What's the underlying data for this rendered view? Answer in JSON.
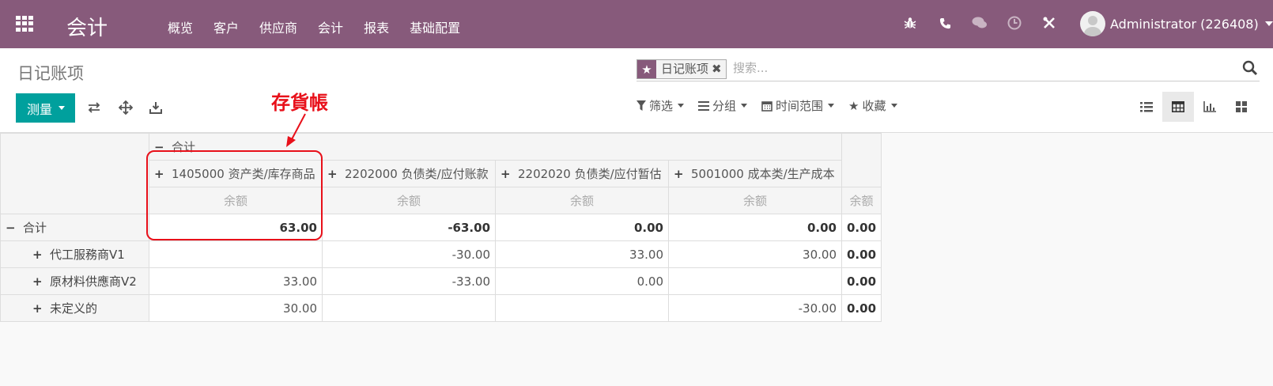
{
  "navbar": {
    "brand": "会计",
    "menu": [
      "概览",
      "客户",
      "供应商",
      "会计",
      "报表",
      "基础配置"
    ],
    "user": "Administrator (226408)"
  },
  "control": {
    "breadcrumb": "日记账项",
    "facet_label": "日记账项",
    "search_placeholder": "搜索...",
    "measure_label": "测量",
    "filters": {
      "filter": "筛选",
      "group": "分组",
      "time_range": "时间范围",
      "favorites": "收藏"
    }
  },
  "pivot": {
    "total_header": "合计",
    "columns": [
      "1405000 资产类/库存商品",
      "2202000 负债类/应付账款",
      "2202020 负债类/应付暂估",
      "5001000 成本类/生产成本"
    ],
    "measure": "余额",
    "total_measure": "余额",
    "rows": [
      {
        "label": "合计",
        "expanded": true,
        "values": [
          "63.00",
          "-63.00",
          "0.00",
          "0.00",
          "0.00"
        ]
      },
      {
        "label": "代工服務商V1",
        "expanded": false,
        "values": [
          "",
          "-30.00",
          "33.00",
          "30.00",
          "0.00"
        ]
      },
      {
        "label": "原材料供應商V2",
        "expanded": false,
        "values": [
          "33.00",
          "-33.00",
          "0.00",
          "",
          "0.00"
        ]
      },
      {
        "label": "未定义的",
        "expanded": false,
        "values": [
          "30.00",
          "",
          "",
          "-30.00",
          "0.00"
        ]
      }
    ]
  },
  "annotation": {
    "label": "存貨帳",
    "color": "#e8101a"
  },
  "colors": {
    "navbar": "#875a7b",
    "primary_button": "#00a09d"
  }
}
